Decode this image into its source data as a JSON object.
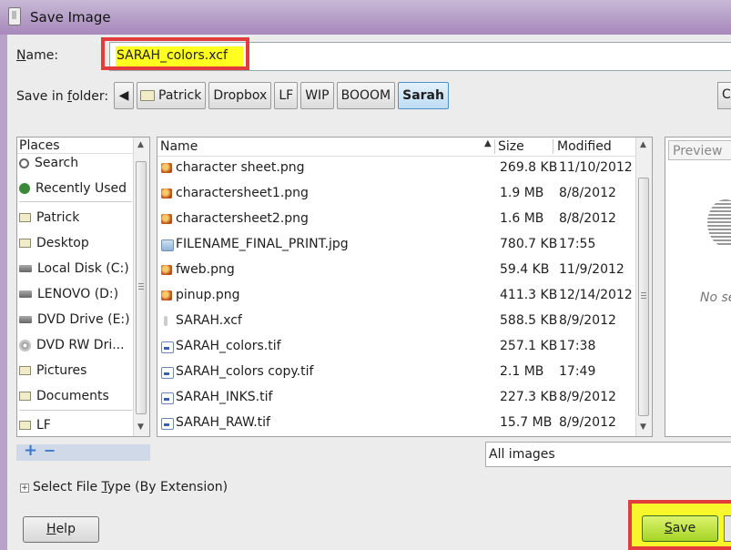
{
  "window": {
    "title": "Save Image"
  },
  "name_row": {
    "label": "Name:",
    "value": "SARAH_colors.xcf"
  },
  "folder_row": {
    "label": "Save in folder:",
    "crumbs": [
      "Patrick",
      "Dropbox",
      "LF",
      "WIP",
      "BOOOM",
      "Sarah"
    ],
    "active_crumb": "Sarah",
    "create_label": "C"
  },
  "places": {
    "header": "Places",
    "items": [
      {
        "label": "Search",
        "icon": "search-icon"
      },
      {
        "label": "Recently Used",
        "icon": "recent-icon"
      },
      {
        "label": "Patrick",
        "icon": "folder-icon"
      },
      {
        "label": "Desktop",
        "icon": "folder-icon"
      },
      {
        "label": "Local Disk (C:)",
        "icon": "disk-icon"
      },
      {
        "label": "LENOVO (D:)",
        "icon": "disk-icon"
      },
      {
        "label": "DVD Drive (E:)",
        "icon": "disk-icon"
      },
      {
        "label": "DVD RW Dri...",
        "icon": "dvd-icon"
      },
      {
        "label": "Pictures",
        "icon": "folder-icon"
      },
      {
        "label": "Documents",
        "icon": "folder-icon"
      },
      {
        "label": "LF",
        "icon": "folder-icon"
      }
    ],
    "add_label": "+",
    "remove_label": "−"
  },
  "files": {
    "columns": {
      "name": "Name",
      "size": "Size",
      "modified": "Modified"
    },
    "rows": [
      {
        "name": "character sheet.png",
        "size": "269.8 KB",
        "modified": "11/10/2012",
        "type": "png"
      },
      {
        "name": "charactersheet1.png",
        "size": "1.9 MB",
        "modified": "8/8/2012",
        "type": "png"
      },
      {
        "name": "charactersheet2.png",
        "size": "1.6 MB",
        "modified": "8/8/2012",
        "type": "png"
      },
      {
        "name": "FILENAME_FINAL_PRINT.jpg",
        "size": "780.7 KB",
        "modified": "17:55",
        "type": "jpg"
      },
      {
        "name": "fweb.png",
        "size": "59.4 KB",
        "modified": "11/9/2012",
        "type": "png"
      },
      {
        "name": "pinup.png",
        "size": "411.3 KB",
        "modified": "12/14/2012",
        "type": "png"
      },
      {
        "name": "SARAH.xcf",
        "size": "588.5 KB",
        "modified": "8/9/2012",
        "type": "xcf"
      },
      {
        "name": "SARAH_colors.tif",
        "size": "257.1 KB",
        "modified": "17:38",
        "type": "tif"
      },
      {
        "name": "SARAH_colors copy.tif",
        "size": "2.1 MB",
        "modified": "17:49",
        "type": "tif"
      },
      {
        "name": "SARAH_INKS.tif",
        "size": "227.3 KB",
        "modified": "8/9/2012",
        "type": "tif"
      },
      {
        "name": "SARAH_RAW.tif",
        "size": "15.7 MB",
        "modified": "8/9/2012",
        "type": "tif"
      }
    ]
  },
  "preview": {
    "label": "Preview",
    "no_selection": "No se"
  },
  "filter": {
    "value": "All images"
  },
  "expander": {
    "label_pre": "Select File ",
    "label_mn": "T",
    "label_post": "ype (By Extension)"
  },
  "buttons": {
    "help": "Help",
    "save": "Save"
  },
  "colors": {
    "highlight_yellow": "#ffff20",
    "annotation_red": "#e33c3c",
    "save_green": "#a6d427",
    "active_crumb_blue": "#bcdcf3"
  }
}
